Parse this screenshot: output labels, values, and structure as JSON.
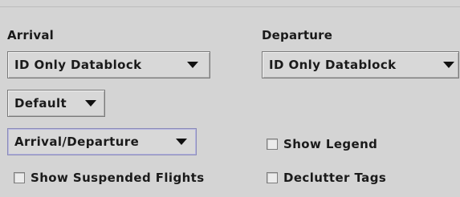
{
  "arrival": {
    "label": "Arrival",
    "datablock_value": "ID Only Datablock",
    "preset_value": "Default",
    "mode_value": "Arrival/Departure"
  },
  "departure": {
    "label": "Departure",
    "datablock_value": "ID Only Datablock"
  },
  "options": {
    "show_legend_label": "Show Legend",
    "show_legend_checked": false,
    "show_suspended_label": "Show Suspended Flights",
    "show_suspended_checked": false,
    "declutter_tags_label": "Declutter Tags",
    "declutter_tags_checked": false
  },
  "icons": {
    "combo_arrow": "chevron-down-icon"
  }
}
